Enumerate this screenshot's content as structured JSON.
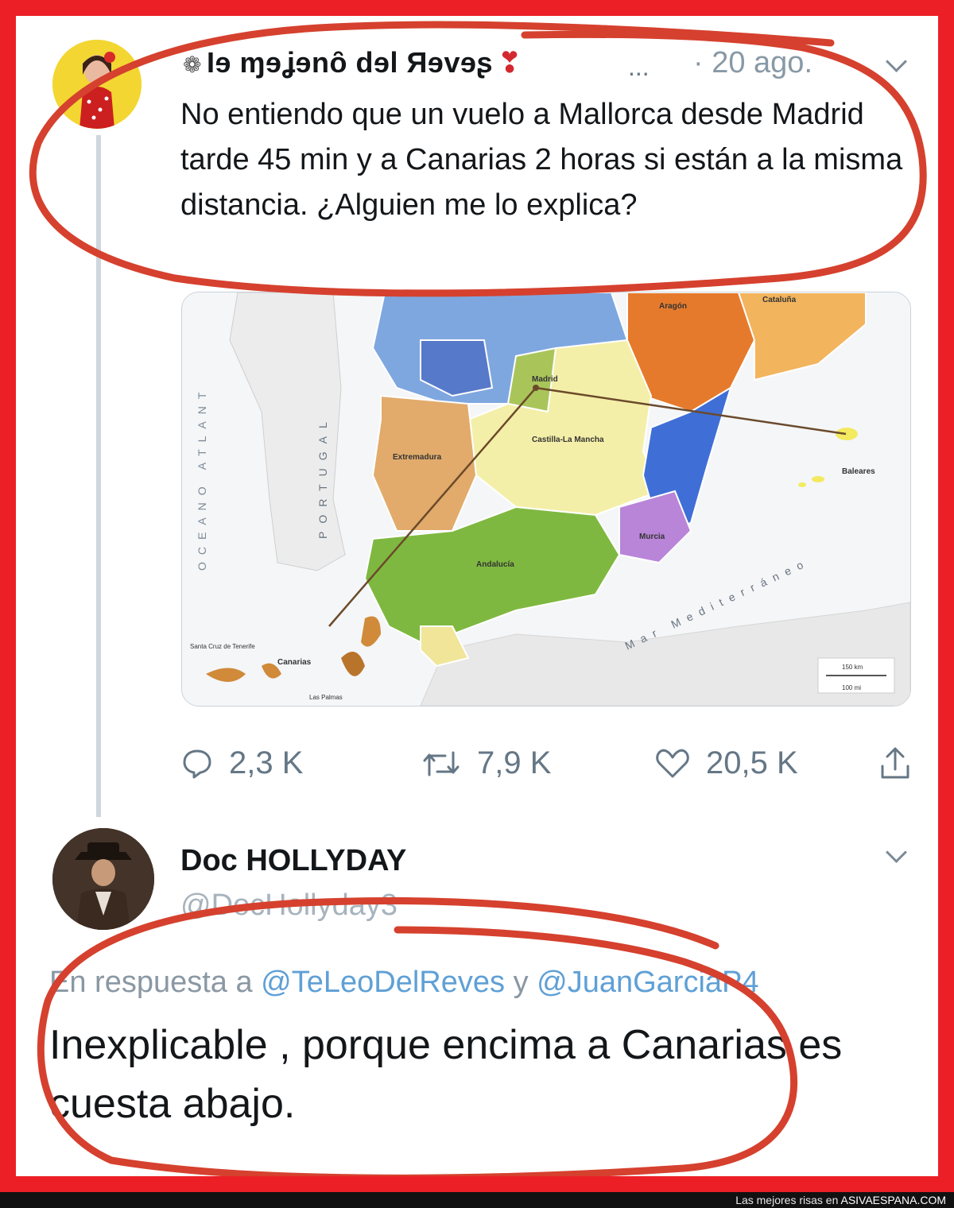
{
  "tweet": {
    "author_name": "Ɩɘ ɱɘʝɘnȏ dɘl Яɘvɘʂ",
    "author_prefix_icon": "flower-icon",
    "author_suffix_icon": "heart-exclamation-icon",
    "more": "...",
    "time": "· 20 ago.",
    "text": "No entiendo que un vuelo a Mallorca desde Madrid tarde 45 min y a Canarias 2 horas si están a la misma distancia. ¿Alguien me lo explica?",
    "stats": {
      "replies": "2,3 K",
      "retweets": "7,9 K",
      "likes": "20,5 K"
    }
  },
  "map": {
    "sea_atlantic": "OCEANO ATLANT",
    "country_portugal": "PORTUGAL",
    "sea_mediterranean": "Mar Mediterráneo",
    "label_madrid": "Madrid",
    "label_castilla": "Castilla-La Mancha",
    "label_extremadura": "Extremadura",
    "label_andalucia": "Andalucía",
    "label_murcia": "Murcia",
    "label_aragon": "Aragón",
    "label_cataluna": "Cataluña",
    "label_baleares": "Baleares",
    "label_canarias": "Canarias",
    "label_tenerife": "Santa Cruz de Tenerife",
    "label_laspalmas": "Las Palmas",
    "scale": "150 km",
    "scale2": "100 mi"
  },
  "reply": {
    "author_name": "Doc HOLLYDAY",
    "handle": "@DocHollyday3",
    "in_reply_prefix": "En respuesta a",
    "mention1": "@TeLeoDelReves",
    "and_word": "y",
    "mention2": "@JuanGarciaP4",
    "text": "Inexplicable , porque encima a Canarias es cuesta abajo."
  },
  "footer": {
    "prefix": "Las mejores risas en",
    "site": "ASIVAESPANA.COM"
  },
  "colors": {
    "frame": "#ec1f26",
    "annotation": "#d5412e",
    "link": "#5fa0d6"
  }
}
